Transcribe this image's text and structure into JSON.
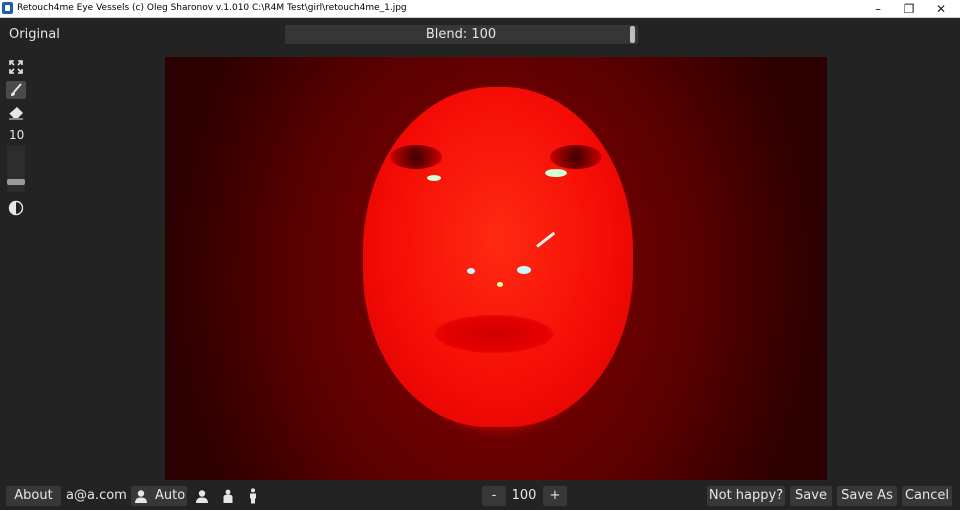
{
  "window": {
    "title": "Retouch4me Eye Vessels (c) Oleg Sharonov v.1.010 C:\\R4M Test\\girl\\retouch4me_1.jpg",
    "controls": {
      "minimize": "–",
      "maximize": "❐",
      "close": "✕"
    }
  },
  "top": {
    "original_label": "Original",
    "blend_label": "Blend: 100",
    "blend_value": 100
  },
  "tools": {
    "icons": [
      "fullscreen-icon",
      "brush-icon",
      "eraser-icon",
      "contrast-icon"
    ],
    "brush_size": "10",
    "brush_size_level": 0.1
  },
  "bottom": {
    "about_label": "About",
    "email": "a@a.com",
    "auto_label": "Auto",
    "zoom_minus": "-",
    "zoom_value": "100",
    "zoom_plus": "+",
    "not_happy_label": "Not happy?",
    "save_label": "Save",
    "save_as_label": "Save As",
    "cancel_label": "Cancel"
  },
  "colors": {
    "background": "#232323",
    "button": "#383838",
    "text": "#e6e6e6",
    "photo_tint": "#ff0000"
  }
}
